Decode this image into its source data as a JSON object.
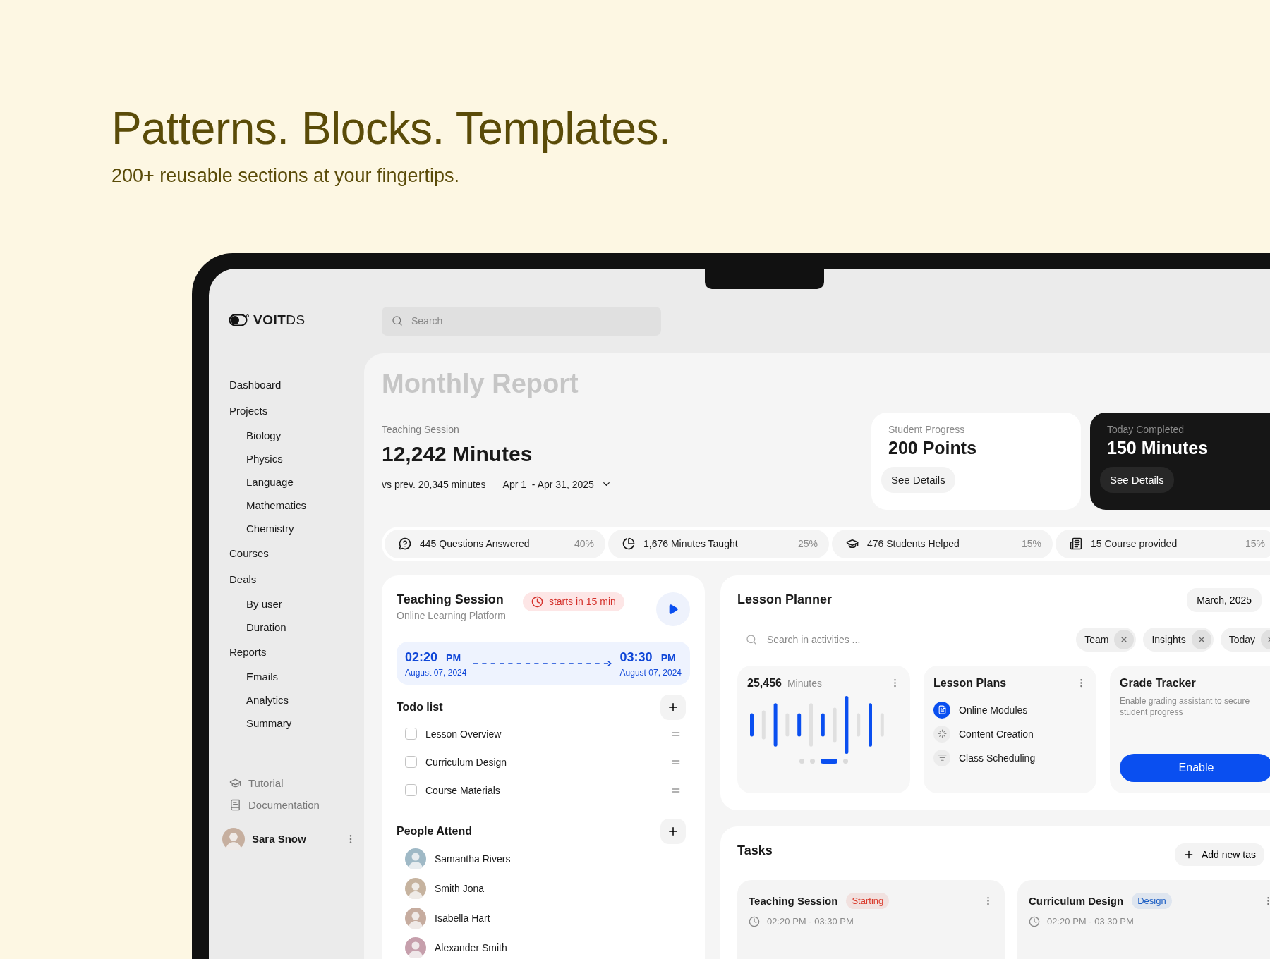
{
  "hero": {
    "title": "Patterns. Blocks. Templates.",
    "subtitle": "200+ reusable sections at your fingertips."
  },
  "logo": {
    "strong": "VOIT",
    "light": "DS"
  },
  "search": {
    "placeholder": "Search"
  },
  "sidebar": {
    "items": [
      {
        "label": "Dashboard"
      },
      {
        "label": "Projects",
        "children": [
          {
            "label": "Biology"
          },
          {
            "label": "Physics"
          },
          {
            "label": "Language"
          },
          {
            "label": "Mathematics"
          },
          {
            "label": "Chemistry"
          }
        ]
      },
      {
        "label": "Courses"
      },
      {
        "label": "Deals",
        "children": [
          {
            "label": "By user"
          },
          {
            "label": "Duration"
          }
        ]
      },
      {
        "label": "Reports",
        "children": [
          {
            "label": "Emails"
          },
          {
            "label": "Analytics"
          },
          {
            "label": "Summary"
          }
        ]
      }
    ],
    "footer": [
      {
        "label": "Tutorial",
        "kind": "tutorial"
      },
      {
        "label": "Documentation",
        "kind": "docs"
      }
    ],
    "user": {
      "name": "Sara Snow"
    }
  },
  "report": {
    "title": "Monthly Report",
    "label": "Teaching Session",
    "value": "12,242 Minutes",
    "comparison": "vs prev. 20,345 minutes",
    "range": "Apr 1  - Apr 31, 2025"
  },
  "summary_cards": [
    {
      "kind": "light",
      "label": "Student Progress",
      "value": "200 Points",
      "button": "See Details"
    },
    {
      "kind": "dark",
      "label": "Today Completed",
      "value": "150 Minutes",
      "button": "See Details"
    }
  ],
  "stats": [
    {
      "kind": "questions",
      "label": "445 Questions Answered",
      "percent": "40%"
    },
    {
      "kind": "minutes",
      "label": "1,676 Minutes Taught",
      "percent": "25%"
    },
    {
      "kind": "students",
      "label": "476 Students Helped",
      "percent": "15%"
    },
    {
      "kind": "courses",
      "label": "15 Course provided",
      "percent": "15%"
    }
  ],
  "session": {
    "title": "Teaching Session",
    "subtitle": "Online Learning Platform",
    "badge": "starts in 15 min",
    "start": {
      "time": "02:20",
      "period": "PM",
      "date": "August 07, 2024"
    },
    "end": {
      "time": "03:30",
      "period": "PM",
      "date": "August 07, 2024"
    },
    "todo": {
      "title": "Todo list",
      "items": [
        {
          "label": "Lesson Overview",
          "checked": false
        },
        {
          "label": "Curriculum Design",
          "checked": false
        },
        {
          "label": "Course Materials",
          "checked": false
        }
      ]
    },
    "people": {
      "title": "People Attend",
      "items": [
        {
          "name": "Samantha Rivers"
        },
        {
          "name": "Smith Jona"
        },
        {
          "name": "Isabella Hart"
        },
        {
          "name": "Alexander Smith"
        }
      ]
    }
  },
  "planner": {
    "title": "Lesson Planner",
    "month": "March, 2025",
    "search": {
      "placeholder": "Search in activities ..."
    },
    "filters": [
      {
        "label": "Team"
      },
      {
        "label": "Insights"
      },
      {
        "label": "Today"
      }
    ],
    "minutes": {
      "value": "25,456",
      "unit": "Minutes",
      "pages": [
        {
          "selected": false
        },
        {
          "selected": false
        },
        {
          "selected": true
        },
        {
          "selected": false
        }
      ]
    },
    "plans": {
      "title": "Lesson Plans",
      "items": [
        {
          "kind": "modules",
          "label": "Online Modules",
          "selected": true
        },
        {
          "kind": "content",
          "label": "Content Creation",
          "selected": false
        },
        {
          "kind": "schedule",
          "label": "Class Scheduling",
          "selected": false
        }
      ]
    },
    "grade": {
      "title": "Grade Tracker",
      "description": "Enable grading assistant to secure student progress",
      "button": "Enable"
    }
  },
  "tasks": {
    "title": "Tasks",
    "add": "Add new tas",
    "items": [
      {
        "title": "Teaching Session",
        "tag": "Starting",
        "color": "#d93a2b",
        "time": "02:20 PM - 03:30 PM"
      },
      {
        "title": "Curriculum Design",
        "tag": "Design",
        "color": "#1d5fc4",
        "time": "02:20 PM - 03:30 PM"
      }
    ]
  }
}
